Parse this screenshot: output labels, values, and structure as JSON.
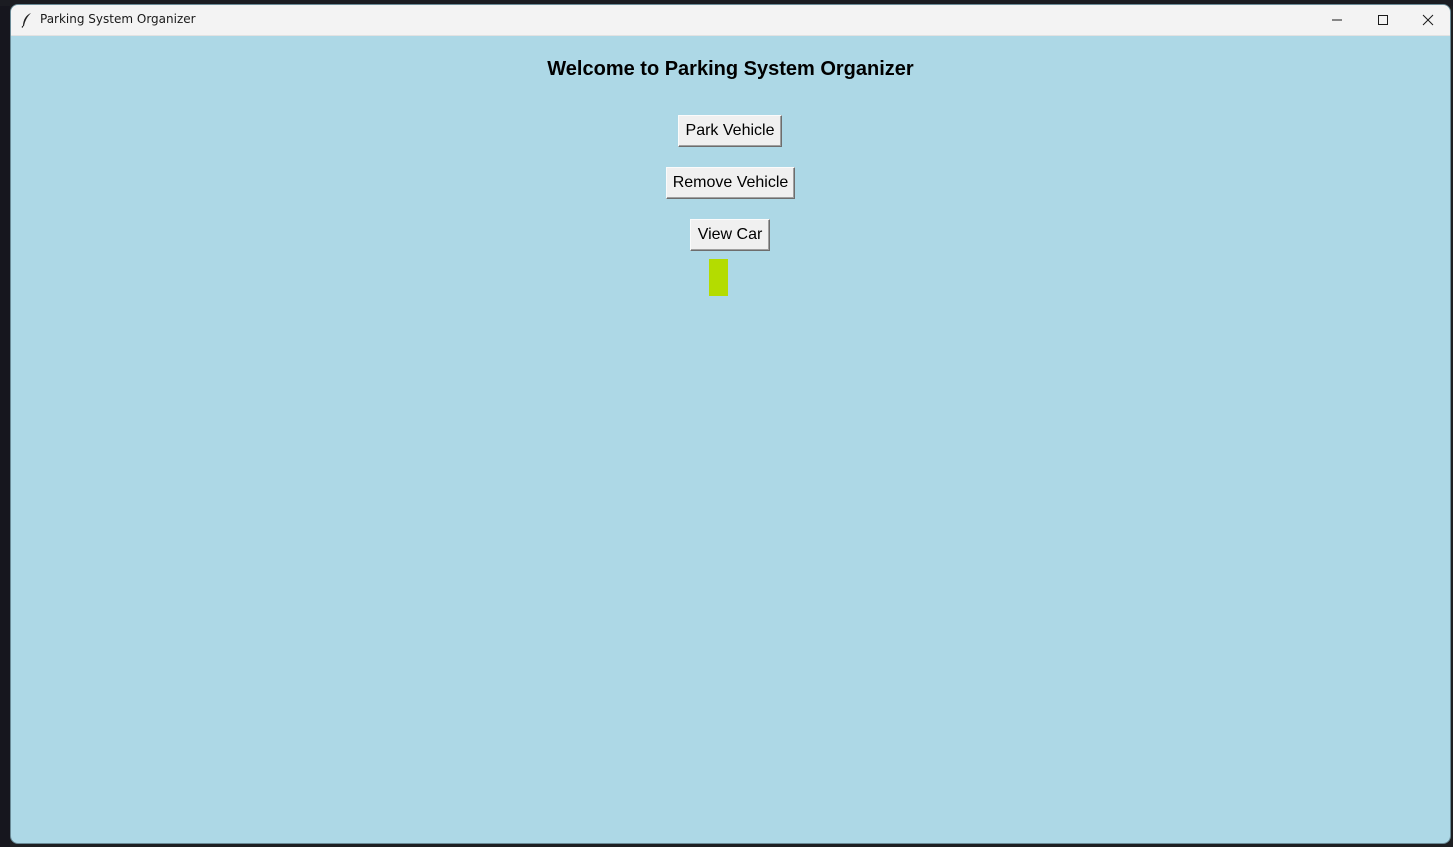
{
  "window": {
    "title": "Parking System Organizer",
    "controls": {
      "minimize": "─",
      "maximize": "☐",
      "close": "✕"
    }
  },
  "main": {
    "heading": "Welcome to Parking System Organizer",
    "buttons": {
      "park": "Park Vehicle",
      "remove": "Remove Vehicle",
      "view": "View Car"
    }
  },
  "colors": {
    "background": "#add8e6",
    "status_block": "#b4dc00"
  }
}
